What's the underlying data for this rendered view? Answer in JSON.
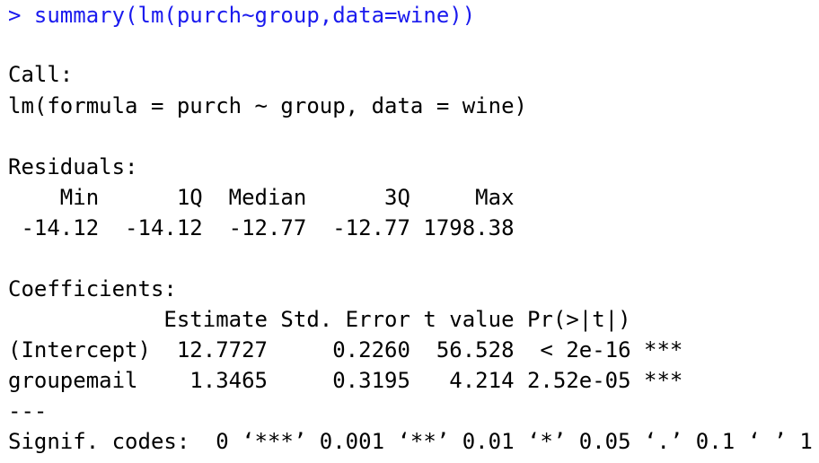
{
  "console": {
    "command": "> summary(lm(purch~group,data=wine))",
    "call_header": "Call:",
    "call_formula": "lm(formula = purch ~ group, data = wine)",
    "residuals_header": "Residuals:",
    "residuals_labels": "    Min      1Q  Median      3Q     Max ",
    "residuals_values": " -14.12  -14.12  -12.77  -12.77 1798.38 ",
    "coefficients_header": "Coefficients:",
    "coef_header_row": "            Estimate Std. Error t value Pr(>|t|)    ",
    "coef_row_intercept": "(Intercept)  12.7727     0.2260  56.528  < 2e-16 ***",
    "coef_row_groupemail": "groupemail    1.3465     0.3195   4.214 2.52e-05 ***",
    "separator": "---",
    "signif_codes": "Signif. codes:  0 ‘***’ 0.001 ‘**’ 0.01 ‘*’ 0.05 ‘.’ 0.1 ‘ ’ 1",
    "colors": {
      "command": "#1a1aee",
      "output": "#000000",
      "background": "#ffffff"
    }
  }
}
